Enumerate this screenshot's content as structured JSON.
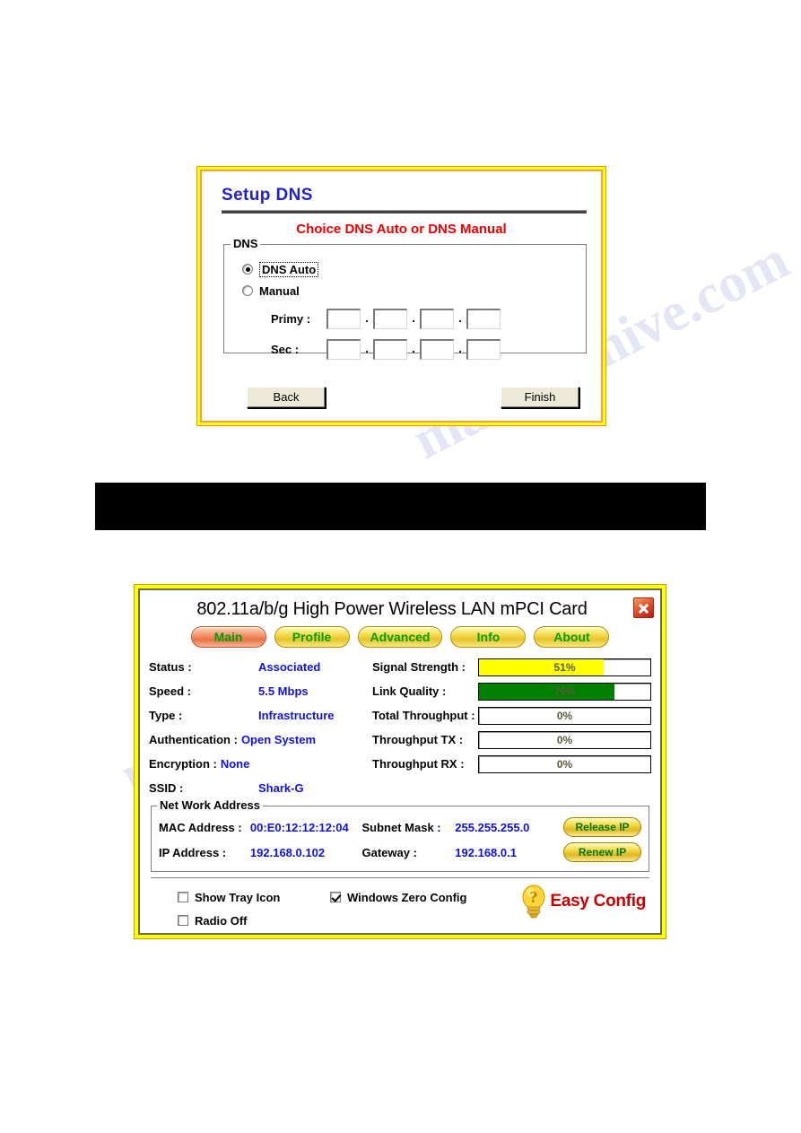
{
  "page": {
    "watermark_text_1": "manualshive.com",
    "watermark_text_2": "manualshive"
  },
  "dns_dialog": {
    "title": "Setup DNS",
    "subtitle": "Choice DNS Auto or DNS Manual",
    "group_legend": "DNS",
    "radio_auto_label": "DNS Auto",
    "radio_manual_label": "Manual",
    "primary_label": "Primy :",
    "secondary_label": "Sec :",
    "dot": ".",
    "octet_value": "",
    "back_label": "Back",
    "finish_label": "Finish"
  },
  "util_dialog": {
    "title": "802.11a/b/g High Power Wireless LAN mPCI Card",
    "close_icon": "close-icon",
    "tabs": [
      {
        "label": "Main",
        "active": true
      },
      {
        "label": "Profile",
        "active": false
      },
      {
        "label": "Advanced",
        "active": false
      },
      {
        "label": "Info",
        "active": false
      },
      {
        "label": "About",
        "active": false
      }
    ],
    "status_fields": [
      {
        "label": "Status :",
        "value": "Associated"
      },
      {
        "label": "Speed :",
        "value": "5.5 Mbps"
      },
      {
        "label": "Type :",
        "value": "Infrastructure"
      },
      {
        "label": "Authentication :",
        "value": "Open System"
      },
      {
        "label": "Encryption :",
        "value": "None"
      },
      {
        "label": "SSID :",
        "value": "Shark-G"
      }
    ],
    "meters": [
      {
        "label": "Signal Strength :",
        "value": "51%",
        "percent": 73,
        "color": "#ffff00"
      },
      {
        "label": "Link Quality :",
        "value": "79%",
        "percent": 79,
        "color": "#008000"
      },
      {
        "label": "Total Throughput :",
        "value": "0%",
        "percent": 0,
        "color": "#008000"
      },
      {
        "label": "Throughput TX :",
        "value": "0%",
        "percent": 0,
        "color": "#008000"
      },
      {
        "label": "Throughput RX :",
        "value": "0%",
        "percent": 0,
        "color": "#008000"
      }
    ],
    "network": {
      "legend": "Net Work Address",
      "mac_label": "MAC Address :",
      "mac_value": "00:E0:12:12:12:04",
      "subnet_label": "Subnet Mask :",
      "subnet_value": "255.255.255.0",
      "ip_label": "IP Address :",
      "ip_value": "192.168.0.102",
      "gateway_label": "Gateway :",
      "gateway_value": "192.168.0.1",
      "release_label": "Release IP",
      "renew_label": "Renew IP"
    },
    "checkboxes": [
      {
        "label": "Show Tray Icon",
        "checked": false
      },
      {
        "label": "Radio Off",
        "checked": false
      },
      {
        "label": "Windows Zero Config",
        "checked": true
      }
    ],
    "easy_config_label": "Easy Config",
    "easy_config_icon": "lightbulb-question-icon"
  }
}
